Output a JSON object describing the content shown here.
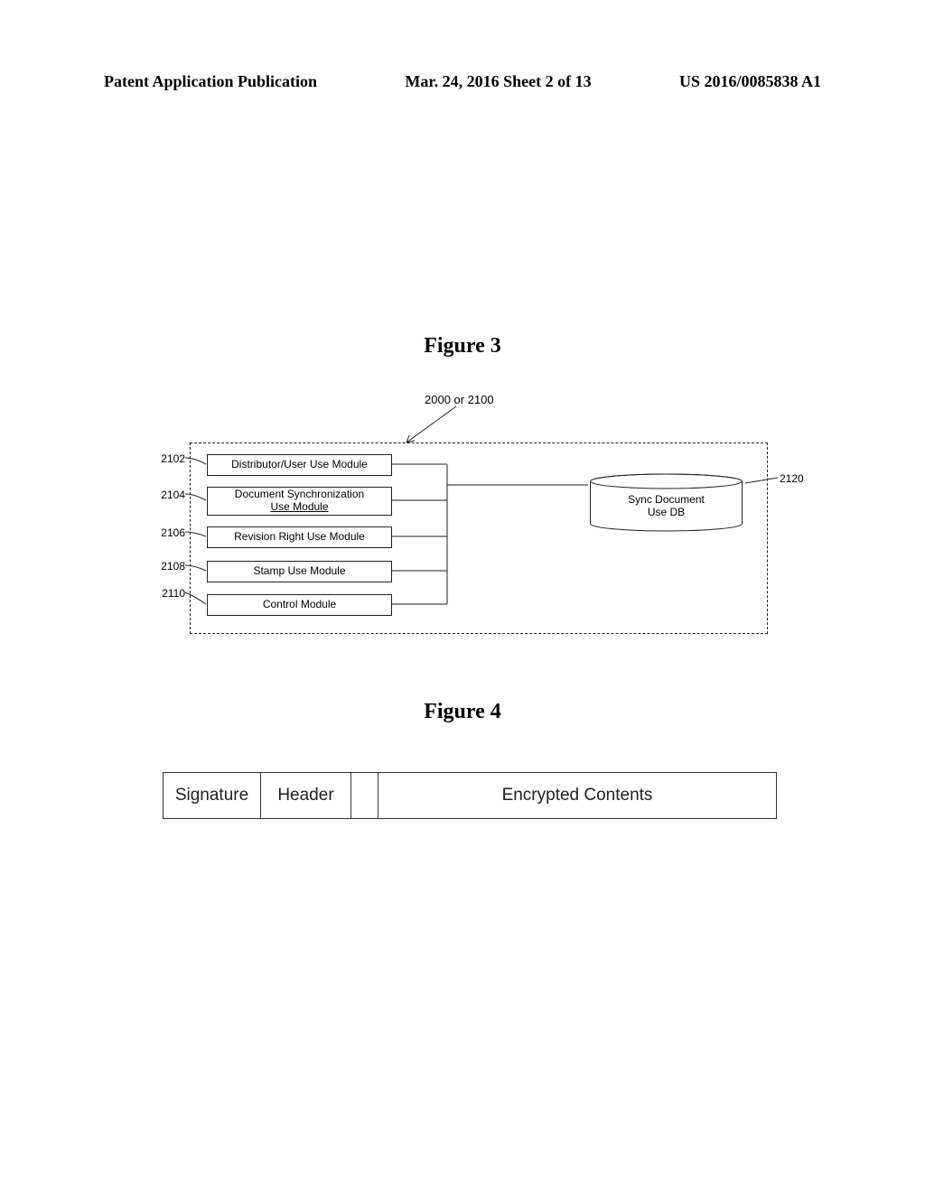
{
  "header": {
    "left": "Patent Application Publication",
    "center": "Mar. 24, 2016  Sheet 2 of 13",
    "right": "US 2016/0085838 A1"
  },
  "figure3": {
    "title": "Figure 3",
    "callout_ref": "2000 or 2100",
    "left_refs": {
      "r2102": "2102",
      "r2104": "2104",
      "r2106": "2106",
      "r2108": "2108",
      "r2110": "2110"
    },
    "right_ref": "2120",
    "modules": {
      "m1": "Distributor/User  Use Module",
      "m2_line1": "Document  Synchronization",
      "m2_line2": "Use Module",
      "m3": "Revision Right Use Module",
      "m4": "Stamp Use Module",
      "m5": "Control Module"
    },
    "db_line1": "Sync Document",
    "db_line2": "Use DB"
  },
  "figure4": {
    "title": "Figure 4",
    "cells": {
      "signature": "Signature",
      "header": "Header",
      "encrypted": "Encrypted Contents"
    }
  }
}
